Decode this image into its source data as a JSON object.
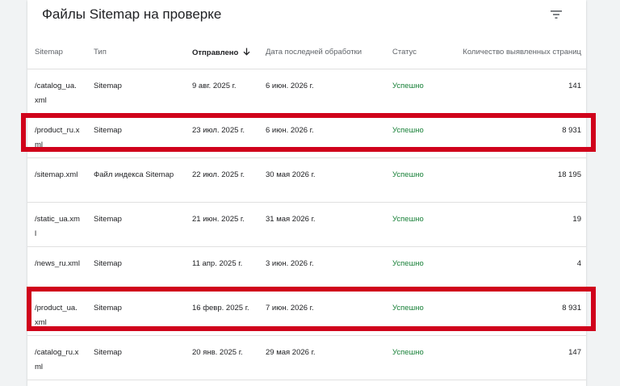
{
  "header": {
    "title": "Файлы Sitemap на проверке",
    "filter_icon": "filter-list-icon"
  },
  "columns": {
    "sitemap": "Sitemap",
    "type": "Тип",
    "sent": "Отправлено",
    "last_processed": "Дата последней обработки",
    "status": "Статус",
    "discovered": "Количество выявленных страниц"
  },
  "sort_icon": "arrow-down-icon",
  "rows": [
    {
      "sitemap": "/catalog_ua.xml",
      "type": "Sitemap",
      "sent": "9 авг. 2025 г.",
      "last": "6 июн. 2026 г.",
      "status": "Успешно",
      "count": "141"
    },
    {
      "sitemap": "/product_ru.xml",
      "type": "Sitemap",
      "sent": "23 июл. 2025 г.",
      "last": "6 июн. 2026 г.",
      "status": "Успешно",
      "count": "8 931"
    },
    {
      "sitemap": "/sitemap.xml",
      "type": "Файл индекса Sitemap",
      "sent": "22 июл. 2025 г.",
      "last": "30 мая 2026 г.",
      "status": "Успешно",
      "count": "18 195"
    },
    {
      "sitemap": "/static_ua.xml",
      "type": "Sitemap",
      "sent": "21 июн. 2025 г.",
      "last": "31 мая 2026 г.",
      "status": "Успешно",
      "count": "19"
    },
    {
      "sitemap": "/news_ru.xml",
      "type": "Sitemap",
      "sent": "11 апр. 2025 г.",
      "last": "3 июн. 2026 г.",
      "status": "Успешно",
      "count": "4"
    },
    {
      "sitemap": "/product_ua.xml",
      "type": "Sitemap",
      "sent": "16 февр. 2025 г.",
      "last": "7 июн. 2026 г.",
      "status": "Успешно",
      "count": "8 931"
    },
    {
      "sitemap": "/catalog_ru.xml",
      "type": "Sitemap",
      "sent": "20 янв. 2025 г.",
      "last": "29 мая 2026 г.",
      "status": "Успешно",
      "count": "147"
    }
  ],
  "colors": {
    "status_success": "#188038",
    "highlight": "#d0021b",
    "divider": "#e0e0e0"
  }
}
